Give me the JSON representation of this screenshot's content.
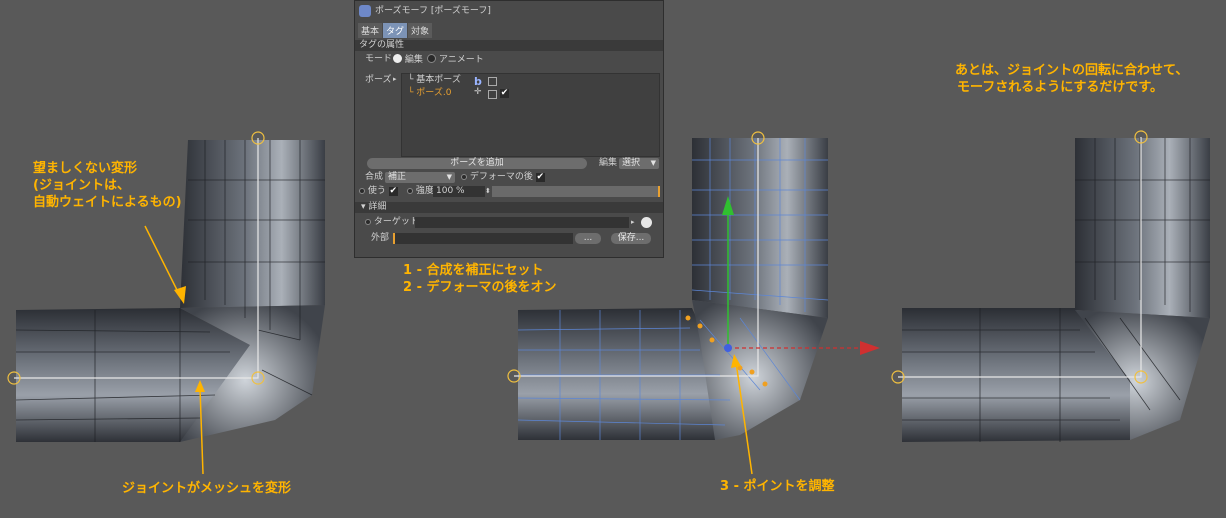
{
  "annotations": {
    "undesired_lines": [
      "望ましくない変形",
      "(ジョイントは、",
      "自動ウェイトによるもの)"
    ],
    "joint_deform": "ジョイントがメッシュを変形",
    "steps_lines": [
      "1 - 合成を補正にセット",
      "2 - デフォーマの後をオン"
    ],
    "step3": "3 - ポイントを調整",
    "final_lines": [
      "あとは、ジョイントの回転に合わせて、",
      "モーフされるようにするだけです。"
    ]
  },
  "panel": {
    "title": "ポーズモーフ [ポーズモーフ]",
    "tabs": [
      "基本",
      "タグ",
      "対象"
    ],
    "section_header": "タグの属性",
    "mode_label": "モード",
    "mode_options": [
      "編集",
      "アニメート"
    ],
    "pose_label": "ポーズ",
    "pose_items": [
      "基本ポーズ",
      "ポーズ.0"
    ],
    "add_pose_button": "ポーズを追加",
    "edit_label": "編集",
    "edit_value": "選択",
    "blend_label": "合成",
    "blend_value": "補正",
    "after_deformer_label": "デフォーマの後",
    "use_label": "使う",
    "strength_label": "強度",
    "strength_value": "100 %",
    "details_header": "▾ 詳細",
    "target_label": "ターゲット",
    "external_label": "外部",
    "browse_button": "...",
    "save_button": "保存..."
  },
  "colors": {
    "annotation": "#ffb400",
    "background": "#595959",
    "panel": "#4a4a4a",
    "tab_active": "#7c93b6",
    "selection": "#3f6ec8"
  }
}
